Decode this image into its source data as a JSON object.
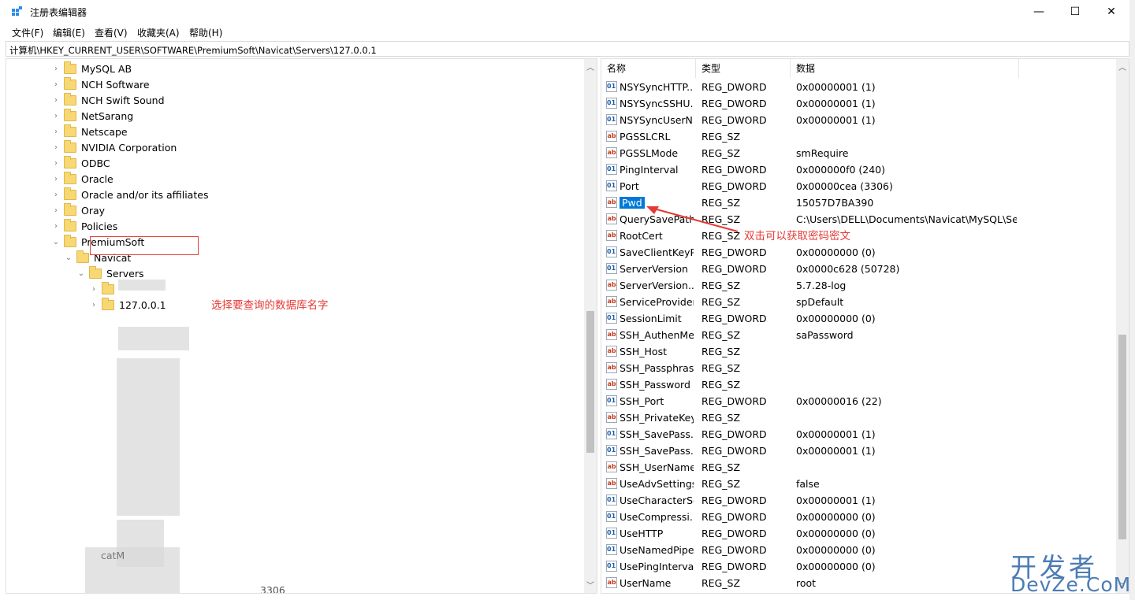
{
  "window": {
    "title": "注册表编辑器",
    "minimize_glyph": "—",
    "maximize_glyph": "☐",
    "close_glyph": "✕"
  },
  "menu": [
    "文件(F)",
    "编辑(E)",
    "查看(V)",
    "收藏夹(A)",
    "帮助(H)"
  ],
  "address": "计算机\\HKEY_CURRENT_USER\\SOFTWARE\\PremiumSoft\\Navicat\\Servers\\127.0.0.1",
  "tree": {
    "items": [
      {
        "label": "MySQL AB"
      },
      {
        "label": "NCH Software"
      },
      {
        "label": "NCH Swift Sound"
      },
      {
        "label": "NetSarang"
      },
      {
        "label": "Netscape"
      },
      {
        "label": "NVIDIA Corporation"
      },
      {
        "label": "ODBC"
      },
      {
        "label": "Oracle"
      },
      {
        "label": "Oracle and/or its affiliates"
      },
      {
        "label": "Oray"
      },
      {
        "label": "Policies"
      },
      {
        "label": "PremiumSoft"
      },
      {
        "label": "Navicat"
      },
      {
        "label": "Servers"
      },
      {
        "label": "127.0.0.1"
      }
    ],
    "partial_label": "catM",
    "bottom_label": "3306"
  },
  "annotations": {
    "left": "选择要查询的数据库名字",
    "right": "双击可以获取密码密文"
  },
  "list": {
    "headers": {
      "name": "名称",
      "type": "类型",
      "data": "数据"
    },
    "rows": [
      {
        "name": "NSYSyncHTTP...",
        "type": "REG_DWORD",
        "data": "0x00000001 (1)",
        "icon": "dword-value-icon"
      },
      {
        "name": "NSYSyncSSHU...",
        "type": "REG_DWORD",
        "data": "0x00000001 (1)",
        "icon": "dword-value-icon"
      },
      {
        "name": "NSYSyncUserN...",
        "type": "REG_DWORD",
        "data": "0x00000001 (1)",
        "icon": "dword-value-icon"
      },
      {
        "name": "PGSSLCRL",
        "type": "REG_SZ",
        "data": "",
        "icon": "string-value-icon"
      },
      {
        "name": "PGSSLMode",
        "type": "REG_SZ",
        "data": "smRequire",
        "icon": "string-value-icon"
      },
      {
        "name": "PingInterval",
        "type": "REG_DWORD",
        "data": "0x000000f0 (240)",
        "icon": "dword-value-icon"
      },
      {
        "name": "Port",
        "type": "REG_DWORD",
        "data": "0x00000cea (3306)",
        "icon": "dword-value-icon"
      },
      {
        "name": "Pwd",
        "type": "REG_SZ",
        "data": "15057D7BA390",
        "icon": "string-value-icon"
      },
      {
        "name": "QuerySavePath",
        "type": "REG_SZ",
        "data": "C:\\Users\\DELL\\Documents\\Navicat\\MySQL\\Se...",
        "icon": "string-value-icon"
      },
      {
        "name": "RootCert",
        "type": "REG_SZ",
        "data": "",
        "icon": "string-value-icon"
      },
      {
        "name": "SaveClientKeyP...",
        "type": "REG_DWORD",
        "data": "0x00000000 (0)",
        "icon": "dword-value-icon"
      },
      {
        "name": "ServerVersion",
        "type": "REG_DWORD",
        "data": "0x0000c628 (50728)",
        "icon": "dword-value-icon"
      },
      {
        "name": "ServerVersion...",
        "type": "REG_SZ",
        "data": "5.7.28-log",
        "icon": "string-value-icon"
      },
      {
        "name": "ServiceProvider",
        "type": "REG_SZ",
        "data": "spDefault",
        "icon": "string-value-icon"
      },
      {
        "name": "SessionLimit",
        "type": "REG_DWORD",
        "data": "0x00000000 (0)",
        "icon": "dword-value-icon"
      },
      {
        "name": "SSH_AuthenMe...",
        "type": "REG_SZ",
        "data": "saPassword",
        "icon": "string-value-icon"
      },
      {
        "name": "SSH_Host",
        "type": "REG_SZ",
        "data": "",
        "icon": "string-value-icon"
      },
      {
        "name": "SSH_Passphrase",
        "type": "REG_SZ",
        "data": "",
        "icon": "string-value-icon"
      },
      {
        "name": "SSH_Password",
        "type": "REG_SZ",
        "data": "",
        "icon": "string-value-icon"
      },
      {
        "name": "SSH_Port",
        "type": "REG_DWORD",
        "data": "0x00000016 (22)",
        "icon": "dword-value-icon"
      },
      {
        "name": "SSH_PrivateKey",
        "type": "REG_SZ",
        "data": "",
        "icon": "string-value-icon"
      },
      {
        "name": "SSH_SavePass...",
        "type": "REG_DWORD",
        "data": "0x00000001 (1)",
        "icon": "dword-value-icon"
      },
      {
        "name": "SSH_SavePass...",
        "type": "REG_DWORD",
        "data": "0x00000001 (1)",
        "icon": "dword-value-icon"
      },
      {
        "name": "SSH_UserName",
        "type": "REG_SZ",
        "data": "",
        "icon": "string-value-icon"
      },
      {
        "name": "UseAdvSettings",
        "type": "REG_SZ",
        "data": "false",
        "icon": "string-value-icon"
      },
      {
        "name": "UseCharacterSet",
        "type": "REG_DWORD",
        "data": "0x00000001 (1)",
        "icon": "dword-value-icon"
      },
      {
        "name": "UseCompressi...",
        "type": "REG_DWORD",
        "data": "0x00000000 (0)",
        "icon": "dword-value-icon"
      },
      {
        "name": "UseHTTP",
        "type": "REG_DWORD",
        "data": "0x00000000 (0)",
        "icon": "dword-value-icon"
      },
      {
        "name": "UseNamedPipe",
        "type": "REG_DWORD",
        "data": "0x00000000 (0)",
        "icon": "dword-value-icon"
      },
      {
        "name": "UsePingInterval",
        "type": "REG_DWORD",
        "data": "0x00000000 (0)",
        "icon": "dword-value-icon"
      },
      {
        "name": "UserName",
        "type": "REG_SZ",
        "data": "root",
        "icon": "string-value-icon"
      }
    ]
  },
  "icons": {
    "sz": "ab",
    "dword": "011"
  },
  "watermark": {
    "line1": "开发者",
    "line2": "DevZe.CoM"
  },
  "colors": {
    "annotation": "#e53935",
    "selection": "#0078d7",
    "watermark": "#4b7cb4"
  }
}
